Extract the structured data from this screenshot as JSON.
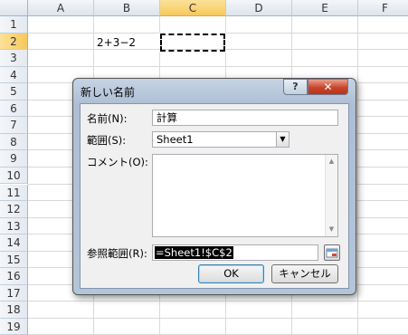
{
  "sheet": {
    "columns": [
      "A",
      "B",
      "C",
      "D",
      "E",
      "F"
    ],
    "rows": [
      "1",
      "2",
      "3",
      "4",
      "5",
      "6",
      "7",
      "8",
      "9",
      "10",
      "11",
      "12",
      "13",
      "14",
      "15",
      "16",
      "17",
      "18",
      "19"
    ],
    "cell_b2": "2+3−2",
    "selected_column": "C",
    "selected_row": "2"
  },
  "dialog": {
    "title": "新しい名前",
    "help_label": "?",
    "close_label": "✕",
    "name_label": "名前(N):",
    "name_value": "計算",
    "scope_label": "範囲(S):",
    "scope_value": "Sheet1",
    "comment_label": "コメント(O):",
    "comment_value": "",
    "ref_label": "参照範囲(R):",
    "ref_value": "=Sheet1!$C$2",
    "ok_label": "OK",
    "cancel_label": "キャンセル"
  },
  "icons": {
    "scope_dropdown": "chevron-down-icon",
    "ref_collapse": "collapse-dialog-icon",
    "scroll_up": "scroll-up-icon",
    "scroll_down": "scroll-down-icon"
  }
}
